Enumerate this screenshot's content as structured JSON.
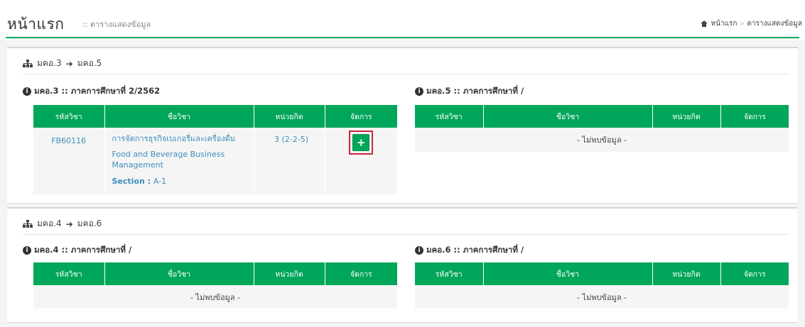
{
  "header": {
    "title": "หน้าแรก",
    "subtitle": ":: ตารางแสดงข้อมูล",
    "breadcrumb": {
      "home": "หน้าแรก",
      "sep": "»",
      "current": "ตารางแสดงข้อมูล"
    }
  },
  "colors": {
    "accent": "#00a65a",
    "link": "#3c8dbc",
    "highlight": "#c7283a"
  },
  "boxes": [
    {
      "from": "มคอ.3",
      "to": "มคอ.5",
      "left": {
        "title": "มคอ.3 :: ภาคการศึกษาที่ 2/2562",
        "columns": [
          "รหัสวิชา",
          "ชื่อวิชา",
          "หน่วยกิต",
          "จัดการ"
        ],
        "rows": [
          {
            "code": "FB60116",
            "name_th": "การจัดการธุรกิจเบเกอรี่และเครื่องดื่ม",
            "name_en": "Food and Beverage Business Management",
            "section_label": "Section :",
            "section_value": "A-1",
            "credit": "3 (2-2-5)",
            "action": "+"
          }
        ]
      },
      "right": {
        "title": "มคอ.5 :: ภาคการศึกษาที่ /",
        "columns": [
          "รหัสวิชา",
          "ชื่อวิชา",
          "หน่วยกิต",
          "จัดการ"
        ],
        "empty": "- ไม่พบข้อมูล -"
      }
    },
    {
      "from": "มคอ.4",
      "to": "มคอ.6",
      "left": {
        "title": "มคอ.4 :: ภาคการศึกษาที่ /",
        "columns": [
          "รหัสวิชา",
          "ชื่อวิชา",
          "หน่วยกิต",
          "จัดการ"
        ],
        "empty": "- ไม่พบข้อมูล -"
      },
      "right": {
        "title": "มคอ.6 :: ภาคการศึกษาที่ /",
        "columns": [
          "รหัสวิชา",
          "ชื่อวิชา",
          "หน่วยกิต",
          "จัดการ"
        ],
        "empty": "- ไม่พบข้อมูล -"
      }
    }
  ]
}
